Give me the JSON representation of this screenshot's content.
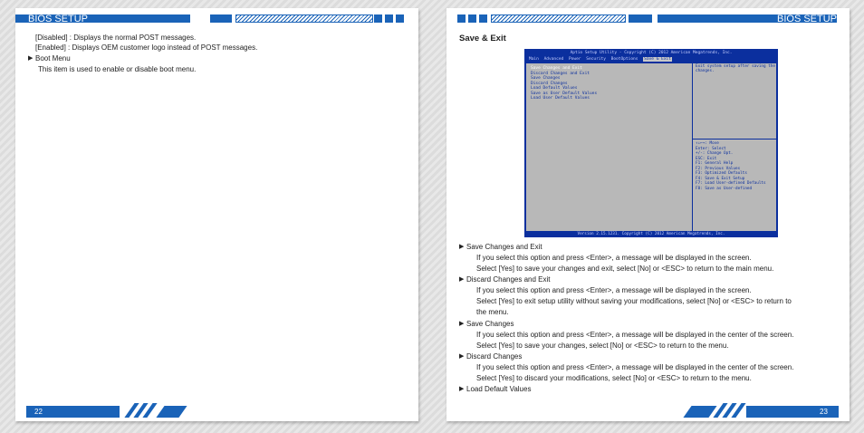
{
  "header": {
    "title": "BIOS SETUP"
  },
  "left_page": {
    "lines": [
      "[Disabled] : Displays the normal POST messages.",
      "[Enabled] : Displays OEM customer logo instead of POST messages."
    ],
    "bullet_item": "Boot Menu",
    "bullet_desc": "This item is used to enable or disable boot menu.",
    "page_number": "22"
  },
  "right_page": {
    "section_title": "Save & Exit",
    "page_number": "23",
    "items": [
      {
        "title": "Save Changes and Exit",
        "lines": [
          "If you select this option and press <Enter>, a message will be displayed in the screen.",
          "Select [Yes] to save your changes and exit, select [No] or <ESC> to return to the main menu."
        ]
      },
      {
        "title": "Discard Changes and Exit",
        "lines": [
          "If you select this option and press <Enter>,  a message will be displayed in the screen.",
          "Select [Yes] to exit setup utility  without saving your modifications, select [No] or <ESC> to return to",
          "the menu."
        ]
      },
      {
        "title": "Save Changes",
        "lines": [
          "If you select this option and press <Enter>, a message will be displayed in the center of the screen.",
          "Select [Yes] to save your changes, select [No] or <ESC> to return to the menu."
        ]
      },
      {
        "title": "Discard Changes",
        "lines": [
          "If you select this option and press <Enter>, a message will be displayed in the center of the screen.",
          "Select [Yes] to discard your modifications, select [No] or <ESC> to return to the menu."
        ]
      },
      {
        "title": "Load Default Values",
        "lines": []
      }
    ]
  },
  "bios": {
    "title": "Aptio Setup Utility - Copyright (C) 2012 American Megatrends, Inc.",
    "menu": [
      "Main",
      "Advanced",
      "Power",
      "Security",
      "BootOptions",
      "Save & Exit"
    ],
    "selected_menu": "Save & Exit",
    "items": [
      "Save Changes and Exit",
      "Discard Changes and Exit",
      "Save Changes",
      "Discard Changes",
      "Load Default Values",
      "Save as User Default Values",
      "Load User Default Values"
    ],
    "help_text": "Exit system setup after saving the changes.",
    "keys": [
      "↑↓←→: Move",
      "Enter: Select",
      "+/-: Change Opt.",
      "ESC: Exit",
      "F1: General Help",
      "F2: Previous Values",
      "F3: Optimized Defaults",
      "F4: Save & Exit Setup",
      "F7: Load User-defined Defaults",
      "F8: Save as User-defined"
    ],
    "version": "Version 2.15.1231. Copyright (C) 2012 American Megatrends, Inc."
  },
  "colors": {
    "accent": "#1a63b8",
    "bios_blue": "#0b2f9e",
    "bios_gray": "#b8b8b8"
  }
}
